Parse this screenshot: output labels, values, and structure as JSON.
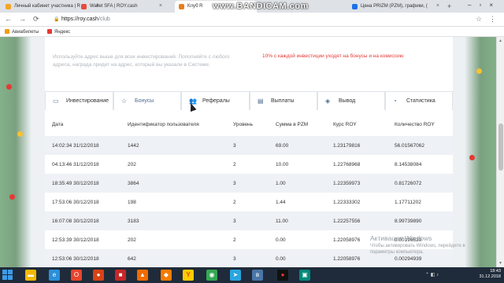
{
  "browser": {
    "tabs": [
      {
        "label": "Личный кабинет участника | R"
      },
      {
        "label": "Wallet SFA | ROY.cash"
      },
      {
        "label": "Клуб R"
      },
      {
        "label": "Цена PRIZM (PZM), графики, ("
      }
    ],
    "url_domain": "https://roy.cash",
    "url_path": "/club",
    "bookmarks": [
      "Авиабилеты",
      "Яндекс"
    ]
  },
  "recorder_watermark": "www.BANDICAM.com",
  "page": {
    "info_left": "Используйте адрес выше для всех инвестирований. Пополняйте с любого адреса, награда придет на адрес, который вы указали в Системе.",
    "info_right": "10% с каждой инвестиции уходят на бонусы и на комиссию",
    "tabs": [
      {
        "label": "Инвестирование",
        "icon": "wallet-icon"
      },
      {
        "label": "Бонусы",
        "icon": "star-icon",
        "active": true
      },
      {
        "label": "Рефералы",
        "icon": "users-icon"
      },
      {
        "label": "Выплаты",
        "icon": "card-icon"
      },
      {
        "label": "Вывод",
        "icon": "withdraw-icon"
      },
      {
        "label": "Статистика",
        "icon": "stats-icon"
      }
    ],
    "table": {
      "headers": [
        "Дата",
        "Идентификатор пользователя",
        "Уровень",
        "Сумма в PZM",
        "Курс ROY",
        "Количество ROY"
      ],
      "rows": [
        [
          "14:02:34 31/12/2018",
          "1442",
          "3",
          "69.00",
          "1.23179816",
          "56.01567062"
        ],
        [
          "04:13:46 31/12/2018",
          "202",
          "2",
          "10.00",
          "1.22768968",
          "8.14538084"
        ],
        [
          "18:35:49 30/12/2018",
          "3864",
          "3",
          "1.00",
          "1.22359973",
          "0.81726072"
        ],
        [
          "17:53:06 30/12/2018",
          "198",
          "2",
          "1.44",
          "1.22333302",
          "1.17711202"
        ],
        [
          "16:07:08 30/12/2018",
          "3183",
          "3",
          "11.00",
          "1.22257556",
          "8.99739890"
        ],
        [
          "12:53:39 30/12/2018",
          "202",
          "2",
          "0.00",
          "1.22058976",
          "0.00196629"
        ],
        [
          "12:53:06 30/12/2018",
          "642",
          "3",
          "0.00",
          "1.22058976",
          "0.00294939"
        ]
      ]
    }
  },
  "windows_activation": {
    "title": "Активация Windows",
    "subtitle": "Чтобы активировать Windows, перейдите в параметры компьютера."
  },
  "taskbar": {
    "time": "18:43",
    "date": "31.12.2018"
  }
}
